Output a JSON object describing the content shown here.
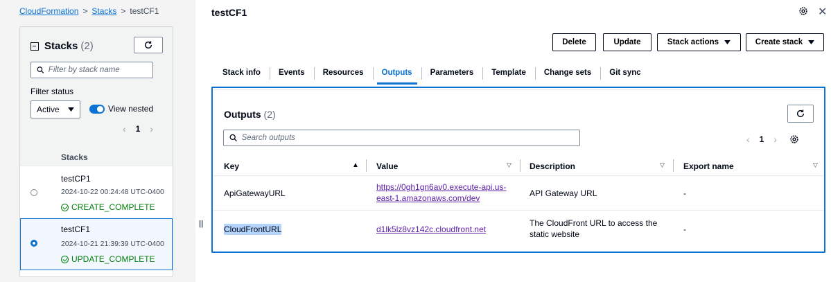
{
  "breadcrumb": {
    "root": "CloudFormation",
    "stacks": "Stacks",
    "current": "testCF1"
  },
  "left_panel": {
    "title": "Stacks",
    "count": "(2)",
    "search_placeholder": "Filter by stack name",
    "filter_status_label": "Filter status",
    "filter_value": "Active",
    "view_nested_label": "View nested",
    "page_number": "1",
    "column_header": "Stacks",
    "stacks": [
      {
        "name": "testCP1",
        "date": "2024-10-22 00:24:48 UTC-0400",
        "status": "CREATE_COMPLETE",
        "selected": false
      },
      {
        "name": "testCF1",
        "date": "2024-10-21 21:39:39 UTC-0400",
        "status": "UPDATE_COMPLETE",
        "selected": true
      }
    ]
  },
  "main": {
    "title": "testCF1",
    "buttons": {
      "delete": "Delete",
      "update": "Update",
      "stack_actions": "Stack actions",
      "create_stack": "Create stack"
    },
    "tabs": [
      "Stack info",
      "Events",
      "Resources",
      "Outputs",
      "Parameters",
      "Template",
      "Change sets",
      "Git sync"
    ],
    "active_tab": "Outputs",
    "outputs": {
      "title": "Outputs",
      "count": "(2)",
      "search_placeholder": "Search outputs",
      "page_number": "1",
      "columns": {
        "key": "Key",
        "value": "Value",
        "description": "Description",
        "export": "Export name"
      },
      "rows": [
        {
          "key": "ApiGatewayURL",
          "value_line1": "https://0gh1gn6av0.execute-api.us-",
          "value_line2": "east-1.amazonaws.com/dev",
          "desc_line1": "API Gateway URL",
          "desc_line2": "",
          "export": "-"
        },
        {
          "key": "CloudFrontURL",
          "value_line1": "d1lk5lz8vz142c.cloudfront.net",
          "value_line2": "",
          "desc_line1": "The CloudFront URL to access the",
          "desc_line2": "static website",
          "export": "-"
        }
      ]
    }
  },
  "colors": {
    "accent": "#0972d3",
    "success": "#037f0c",
    "visited_link": "#5d1ea8"
  }
}
